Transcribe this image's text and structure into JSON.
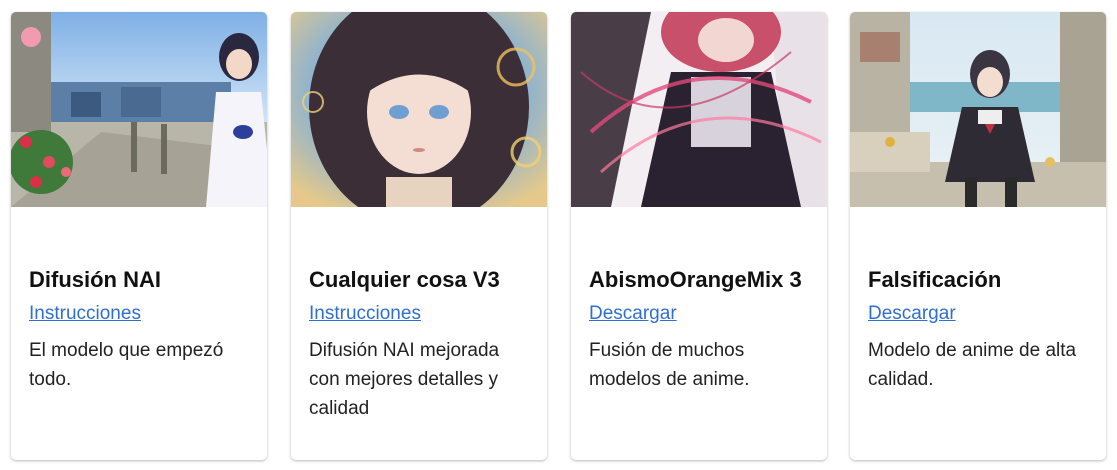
{
  "cards": [
    {
      "title": "Difusión NAI",
      "link": "Instrucciones",
      "description": "El modelo que empezó todo.",
      "image": "anime-girl-balcony-flowers-town"
    },
    {
      "title": "Cualquier cosa V3",
      "link": "Instrucciones",
      "description": "Difusión NAI mejorada con mejores detalles y calidad",
      "image": "anime-girl-portrait-bubbles"
    },
    {
      "title": "AbismoOrangeMix 3",
      "link": "Descargar",
      "description": "Fusión de muchos modelos de anime.",
      "image": "anime-girl-pink-hair-swirls"
    },
    {
      "title": "Falsificación",
      "link": "Descargar",
      "description": "Modelo de anime de alta calidad.",
      "image": "anime-girl-sitting-seaside-ruins"
    }
  ],
  "colors": {
    "link": "#2f6fd1",
    "title": "#111111"
  }
}
